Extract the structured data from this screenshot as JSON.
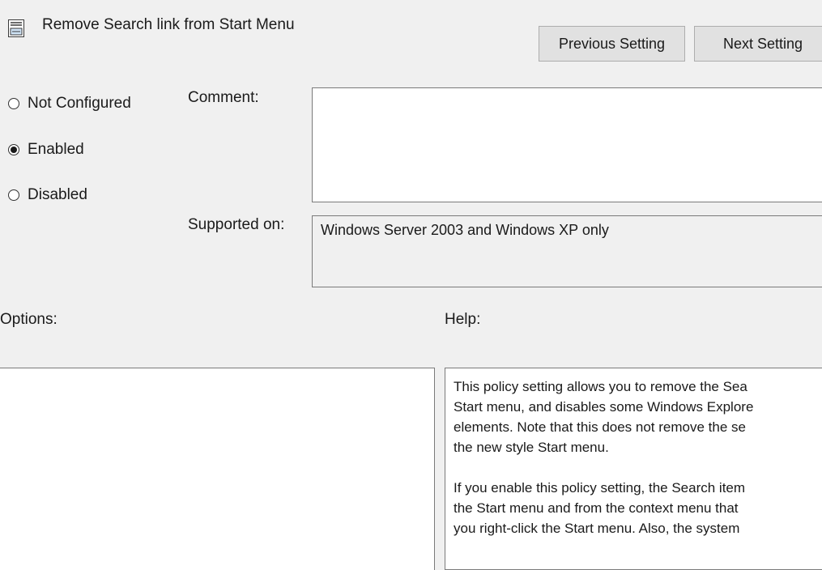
{
  "header": {
    "title": "Remove Search link from Start Menu",
    "previous_label": "Previous Setting",
    "next_label": "Next Setting"
  },
  "state_options": [
    {
      "label": "Not Configured",
      "checked": false
    },
    {
      "label": "Enabled",
      "checked": true
    },
    {
      "label": "Disabled",
      "checked": false
    }
  ],
  "comment": {
    "label": "Comment:",
    "value": ""
  },
  "supported_on": {
    "label": "Supported on:",
    "value": "Windows Server 2003 and Windows XP only"
  },
  "options": {
    "label": "Options:"
  },
  "help": {
    "label": "Help:",
    "paragraph1": [
      "This policy setting allows you to remove the Sea",
      "Start menu, and disables some Windows Explore",
      "elements.  Note that this does not remove the se",
      "the new style Start menu."
    ],
    "paragraph2": [
      "If you enable this policy setting, the Search item",
      "the Start menu and from the context menu that",
      "you right-click the Start menu. Also, the system"
    ]
  },
  "icons": {
    "policy": "policy-setting-icon"
  },
  "colors": {
    "background": "#f0f0f0",
    "button_face": "#e1e1e1",
    "border": "#7a7a7a"
  }
}
